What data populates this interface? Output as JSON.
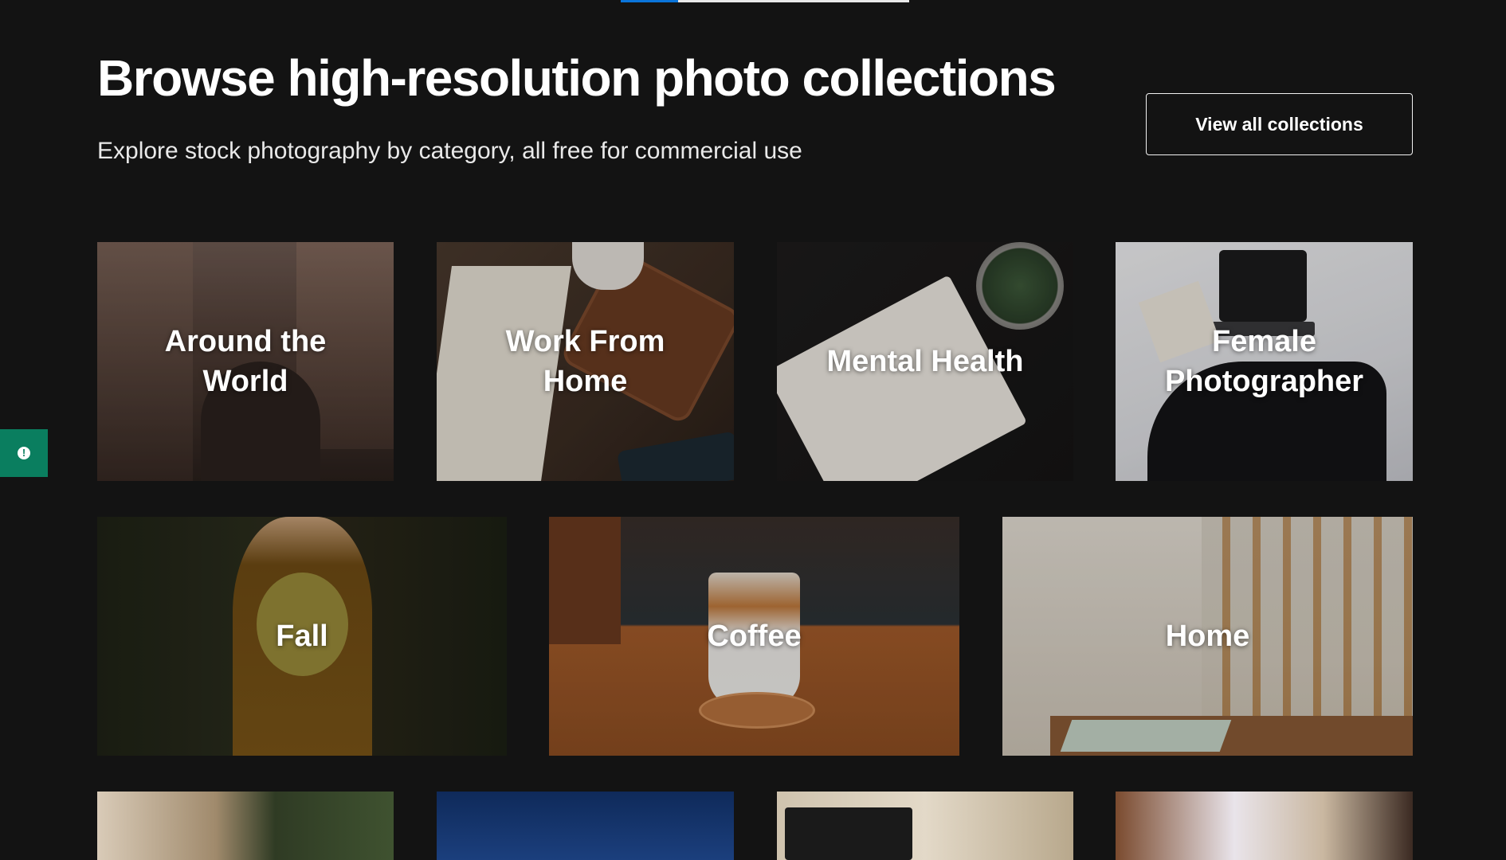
{
  "header": {
    "title": "Browse high-resolution photo collections",
    "subtitle": "Explore stock photography by category, all free for commercial use",
    "view_all_label": "View all collections"
  },
  "scroll_progress": {
    "value_fraction": 0.2
  },
  "feedback_tab": {
    "icon": "alert-circle-icon",
    "glyph": "!"
  },
  "collections": [
    {
      "label": "Around the World",
      "label_lines": [
        "Around the",
        "World"
      ]
    },
    {
      "label": "Work From Home",
      "label_lines": [
        "Work From",
        "Home"
      ]
    },
    {
      "label": "Mental Health",
      "label_lines": [
        "Mental Health"
      ]
    },
    {
      "label": "Female Photographer",
      "label_lines": [
        "Female",
        "Photographer"
      ]
    },
    {
      "label": "Fall",
      "label_lines": [
        "Fall"
      ]
    },
    {
      "label": "Coffee",
      "label_lines": [
        "Coffee"
      ]
    },
    {
      "label": "Home",
      "label_lines": [
        "Home"
      ]
    }
  ],
  "colors": {
    "background": "#131313",
    "accent_blue": "#0a74da",
    "feedback_green": "#0a7e5f"
  }
}
